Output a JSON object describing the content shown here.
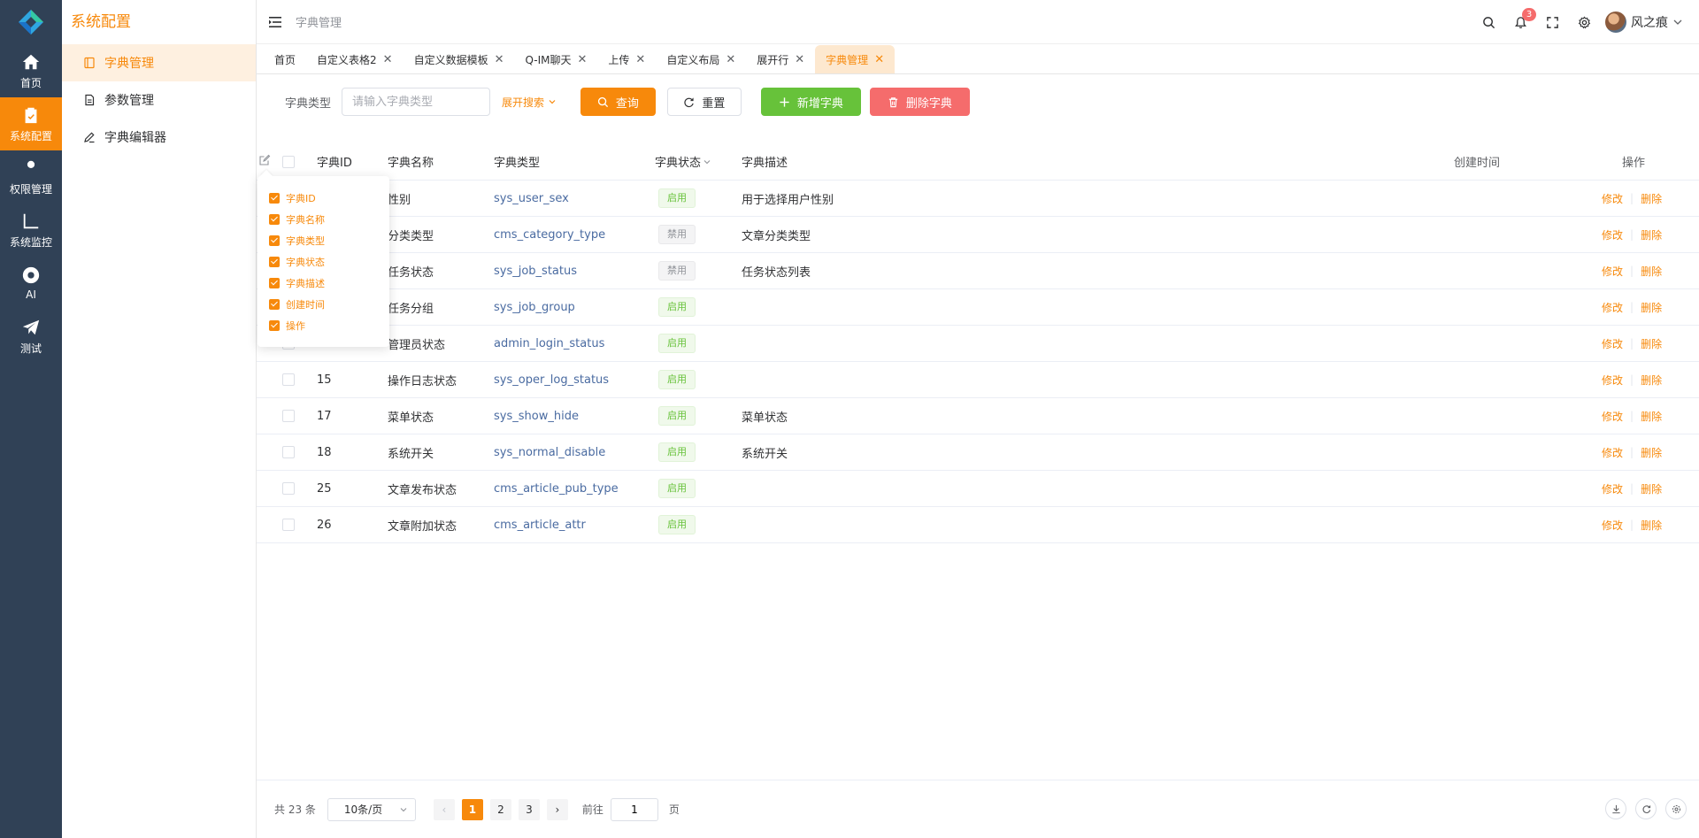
{
  "rail": {
    "items": [
      {
        "label": "首页",
        "icon": "home-icon"
      },
      {
        "label": "系统配置",
        "icon": "clipboard-check-icon",
        "active": true
      },
      {
        "label": "权限管理",
        "icon": "user-icon"
      },
      {
        "label": "系统监控",
        "icon": "chart-line-icon"
      },
      {
        "label": "AI",
        "icon": "chrome-icon"
      },
      {
        "label": "测试",
        "icon": "paper-plane-icon"
      }
    ]
  },
  "submenu": {
    "title": "系统配置",
    "items": [
      {
        "label": "字典管理",
        "icon": "book-icon",
        "active": true
      },
      {
        "label": "参数管理",
        "icon": "document-icon"
      },
      {
        "label": "字典编辑器",
        "icon": "pen-icon"
      }
    ]
  },
  "header": {
    "breadcrumb": "字典管理",
    "notification_count": "3",
    "username": "风之痕"
  },
  "tabs": [
    {
      "label": "首页",
      "closable": false
    },
    {
      "label": "自定义表格2",
      "closable": true
    },
    {
      "label": "自定义数据模板",
      "closable": true
    },
    {
      "label": "Q-IM聊天",
      "closable": true
    },
    {
      "label": "上传",
      "closable": true
    },
    {
      "label": "自定义布局",
      "closable": true
    },
    {
      "label": "展开行",
      "closable": true
    },
    {
      "label": "字典管理",
      "closable": true,
      "active": true
    }
  ],
  "tab_close_glyph": "✕",
  "search": {
    "label": "字典类型",
    "placeholder": "请输入字典类型",
    "value": "",
    "expand_label": "展开搜索",
    "query_label": "查询",
    "reset_label": "重置",
    "add_label": "新增字典",
    "delete_label": "删除字典"
  },
  "table": {
    "columns": [
      "字典ID",
      "字典名称",
      "字典类型",
      "字典状态",
      "字典描述",
      "创建时间",
      "操作"
    ],
    "rows": [
      {
        "id": "",
        "name": "性别",
        "type": "sys_user_sex",
        "status": "启用",
        "enabled": true,
        "desc": "用于选择用户性别"
      },
      {
        "id": "",
        "name": "分类类型",
        "type": "cms_category_type",
        "status": "禁用",
        "enabled": false,
        "desc": "文章分类类型"
      },
      {
        "id": "",
        "name": "任务状态",
        "type": "sys_job_status",
        "status": "禁用",
        "enabled": false,
        "desc": "任务状态列表"
      },
      {
        "id": "",
        "name": "任务分组",
        "type": "sys_job_group",
        "status": "启用",
        "enabled": true,
        "desc": ""
      },
      {
        "id": "",
        "name": "管理员状态",
        "type": "admin_login_status",
        "status": "启用",
        "enabled": true,
        "desc": ""
      },
      {
        "id": "15",
        "name": "操作日志状态",
        "type": "sys_oper_log_status",
        "status": "启用",
        "enabled": true,
        "desc": ""
      },
      {
        "id": "17",
        "name": "菜单状态",
        "type": "sys_show_hide",
        "status": "启用",
        "enabled": true,
        "desc": "菜单状态"
      },
      {
        "id": "18",
        "name": "系统开关",
        "type": "sys_normal_disable",
        "status": "启用",
        "enabled": true,
        "desc": "系统开关"
      },
      {
        "id": "25",
        "name": "文章发布状态",
        "type": "cms_article_pub_type",
        "status": "启用",
        "enabled": true,
        "desc": ""
      },
      {
        "id": "26",
        "name": "文章附加状态",
        "type": "cms_article_attr",
        "status": "启用",
        "enabled": true,
        "desc": ""
      }
    ],
    "edit_label": "修改",
    "delete_label": "删除",
    "separator": "|"
  },
  "column_picker": {
    "items": [
      "字典ID",
      "字典名称",
      "字典类型",
      "字典状态",
      "字典描述",
      "创建时间",
      "操作"
    ]
  },
  "pagination": {
    "total": "共 23 条",
    "page_size": "10条/页",
    "pages": [
      "1",
      "2",
      "3"
    ],
    "current_page": "1",
    "prev": "‹",
    "next": "›",
    "goto_label": "前往",
    "goto_value": "1",
    "goto_suffix": "页"
  },
  "colors": {
    "accent": "#f7890b",
    "rail_bg": "#304156",
    "success": "#67c23a",
    "danger": "#f56c6c"
  }
}
